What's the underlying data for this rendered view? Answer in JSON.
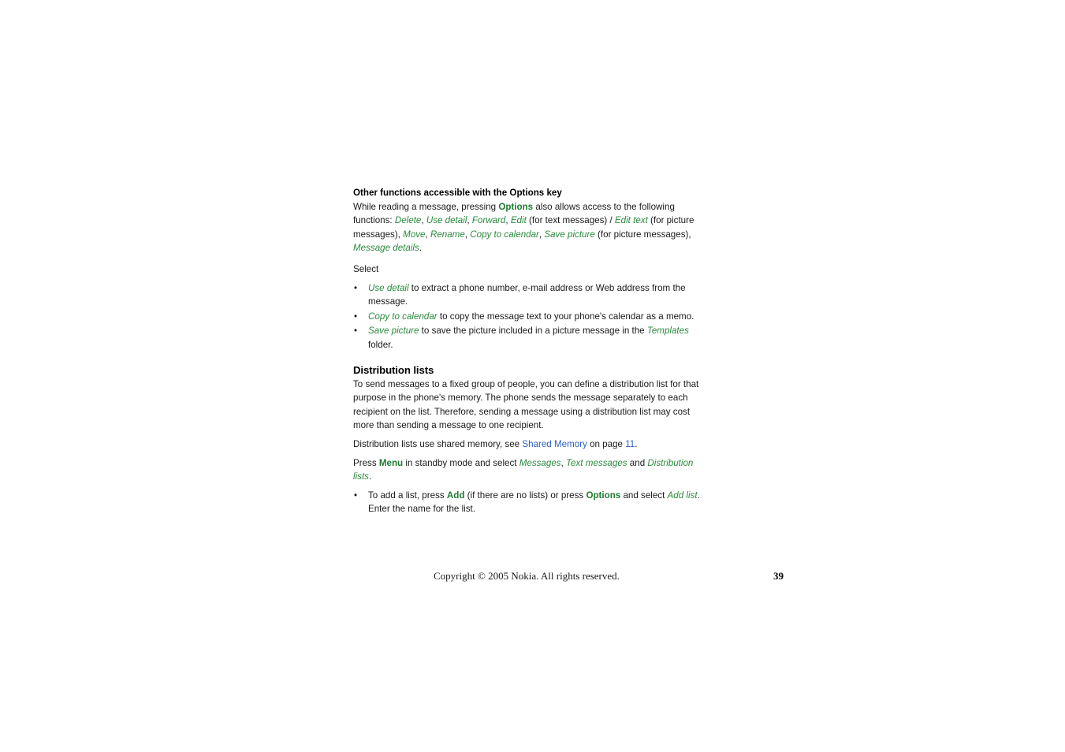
{
  "document": {
    "type": "user-guide-page",
    "page_number": "39",
    "colors": {
      "text": "#1a1a1a",
      "ui_item_green": "#2b8a3e",
      "ui_key_green": "#1f7a30",
      "cross_reference_blue": "#2b5fc4",
      "background": "#ffffff"
    }
  },
  "section_options": {
    "heading": "Other functions accessible with the Options key",
    "intro": {
      "part1": "While reading a message, pressing ",
      "key_options": "Options",
      "part2": " also allows access to the following functions: ",
      "item_delete": "Delete",
      "sep1": ", ",
      "item_use_detail": "Use detail",
      "sep2": ", ",
      "item_forward": "Forward",
      "sep3": ", ",
      "item_edit": "Edit",
      "part3": " (for text messages) / ",
      "item_edit_text": "Edit text",
      "part4": " (for picture messages), ",
      "item_move": "Move",
      "sep4": ", ",
      "item_rename": "Rename",
      "sep5": ", ",
      "item_copy_to_calendar": "Copy to calendar",
      "sep6": ", ",
      "item_save_picture": "Save picture",
      "part5": " (for picture messages), ",
      "item_message_details": "Message details",
      "part6": "."
    },
    "select_label": "Select",
    "bullets": [
      {
        "bullet": "•",
        "item": "Use detail",
        "text": " to extract a phone number, e-mail address or Web address from the message."
      },
      {
        "bullet": "•",
        "item": "Copy to calendar",
        "text": " to copy the message text to your phone's calendar as a memo."
      },
      {
        "bullet": "•",
        "item": "Save picture",
        "text_before": " to save the picture included in a picture message in the ",
        "item2": "Templates",
        "text_after": " folder."
      }
    ]
  },
  "section_distribution": {
    "heading": "Distribution lists",
    "paragraph": "To send messages to a fixed group of people, you can define a distribution list for that purpose in the phone's memory. The phone sends the message separately to each recipient on the list. Therefore, sending a message using a distribution list may cost more than sending a message to one recipient.",
    "shared_memory_note": {
      "part1": "Distribution lists use shared memory, see ",
      "link_shared_memory": "Shared Memory",
      "part2": " on page ",
      "link_page": "11",
      "part3": "."
    },
    "menu_path": {
      "part1": "Press ",
      "key_menu": "Menu",
      "part2": " in standby mode and select ",
      "item_messages": "Messages",
      "sep1": ", ",
      "item_text_messages": "Text messages",
      "part3": " and ",
      "item_distribution_lists": "Distribution lists",
      "part4": "."
    },
    "bullets": [
      {
        "bullet": "•",
        "part1": "To add a list, press ",
        "key_add": "Add",
        "part2": " (if there are no lists) or press ",
        "key_options": "Options",
        "part3": " and select ",
        "item_add_list": "Add list",
        "part4": ". Enter the name for the list."
      }
    ]
  },
  "footer": {
    "copyright": "Copyright © 2005 Nokia. All rights reserved.",
    "page_number": "39"
  }
}
